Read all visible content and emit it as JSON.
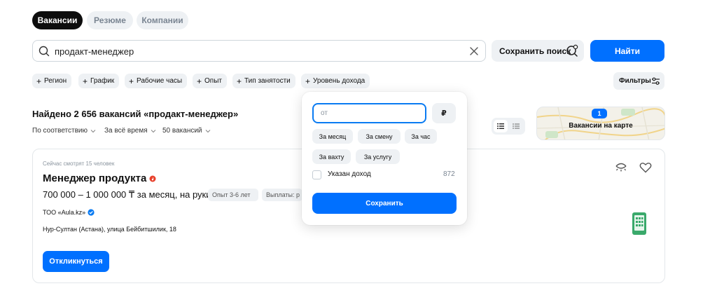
{
  "tabs": [
    {
      "label": "Вакансии",
      "active": true
    },
    {
      "label": "Резюме",
      "active": false
    },
    {
      "label": "Компании",
      "active": false
    }
  ],
  "search": {
    "value": "продакт-менеджер",
    "save_search_label": "Сохранить поиск",
    "find_label": "Найти"
  },
  "filter_chips": [
    "Регион",
    "График",
    "Рабочие часы",
    "Опыт",
    "Тип занятости",
    "Уровень дохода"
  ],
  "filters_button": "Фильтры",
  "results": {
    "found_text": "Найдено 2 656 вакансий «продакт-менеджер»",
    "sort": [
      "По соответствию",
      "За всё время",
      "50 вакансий"
    ],
    "map_label": "Вакансии на карте",
    "map_badge": "1"
  },
  "vacancy": {
    "viewers": "Сейчас смотрят 15 человек",
    "title": "Менеджер продукта",
    "salary": "700 000 – 1 000 000 ₸ за месяц, на руки",
    "tags": [
      "Опыт 3-6 лет",
      "Выплаты: р"
    ],
    "company": "ТОО «Aula.kz»",
    "address": "Нур-Султан (Астана), улица Бейбитшилик, 18",
    "respond_label": "Откликнуться"
  },
  "salary_popup": {
    "placeholder": "от",
    "currency": "₽",
    "periods": [
      "За месяц",
      "За смену",
      "За час",
      "За вахту",
      "За услугу"
    ],
    "checkbox_label": "Указан доход",
    "checkbox_count": "872",
    "save_label": "Сохранить"
  },
  "colors": {
    "accent": "#0070ff",
    "chip_bg": "#eef1f4",
    "hot": "#e8412c",
    "phone": "#3aa96b"
  }
}
